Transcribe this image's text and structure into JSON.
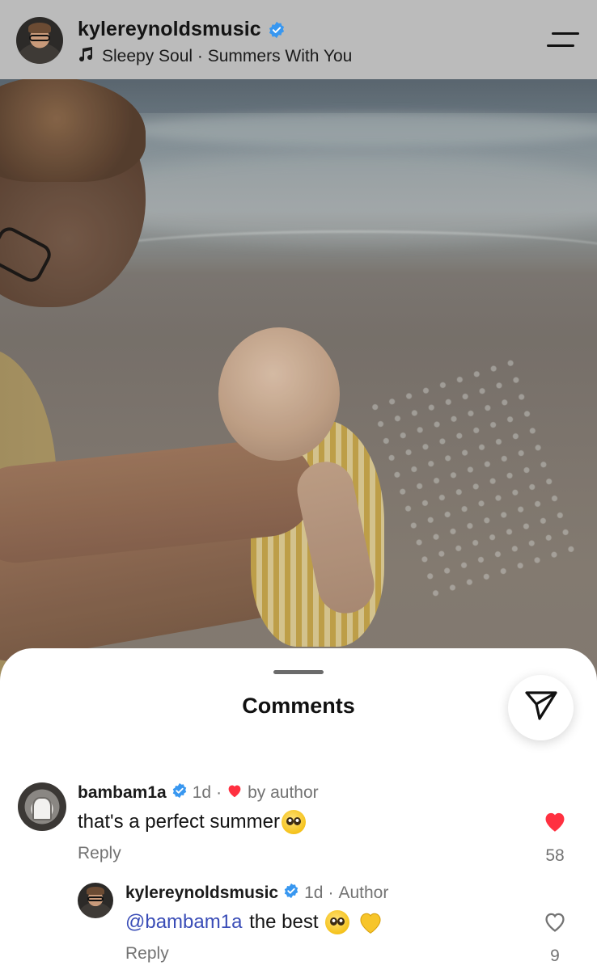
{
  "header": {
    "username": "kylereynoldsmusic",
    "verified": true,
    "music": "Sleepy Soul · Summers With You",
    "menu_icon": "hamburger-menu-icon"
  },
  "photo": {
    "subject_icon": "beach-photo"
  },
  "comments_sheet": {
    "title": "Comments",
    "share_icon": "paper-plane-icon",
    "comments": [
      {
        "username": "bambam1a",
        "verified": true,
        "time": "1d",
        "separator": "·",
        "liked_by_author": "by author",
        "text": "that's a perfect summer",
        "text_emoji": "pleading-face",
        "reply_label": "Reply",
        "like_count": "58",
        "liked": true
      },
      {
        "username": "kylereynoldsmusic",
        "verified": true,
        "time": "1d",
        "separator": "·",
        "badge": "Author",
        "mention": "@bambam1a",
        "text": " the best ",
        "text_emoji": [
          "pleading-face",
          "yellow-heart"
        ],
        "reply_label": "Reply",
        "like_count": "9",
        "liked": false
      }
    ]
  },
  "colors": {
    "verified_blue": "#3897f0",
    "like_red": "#ff3040",
    "mention_blue": "#3a4db7",
    "muted_text": "#737373"
  }
}
